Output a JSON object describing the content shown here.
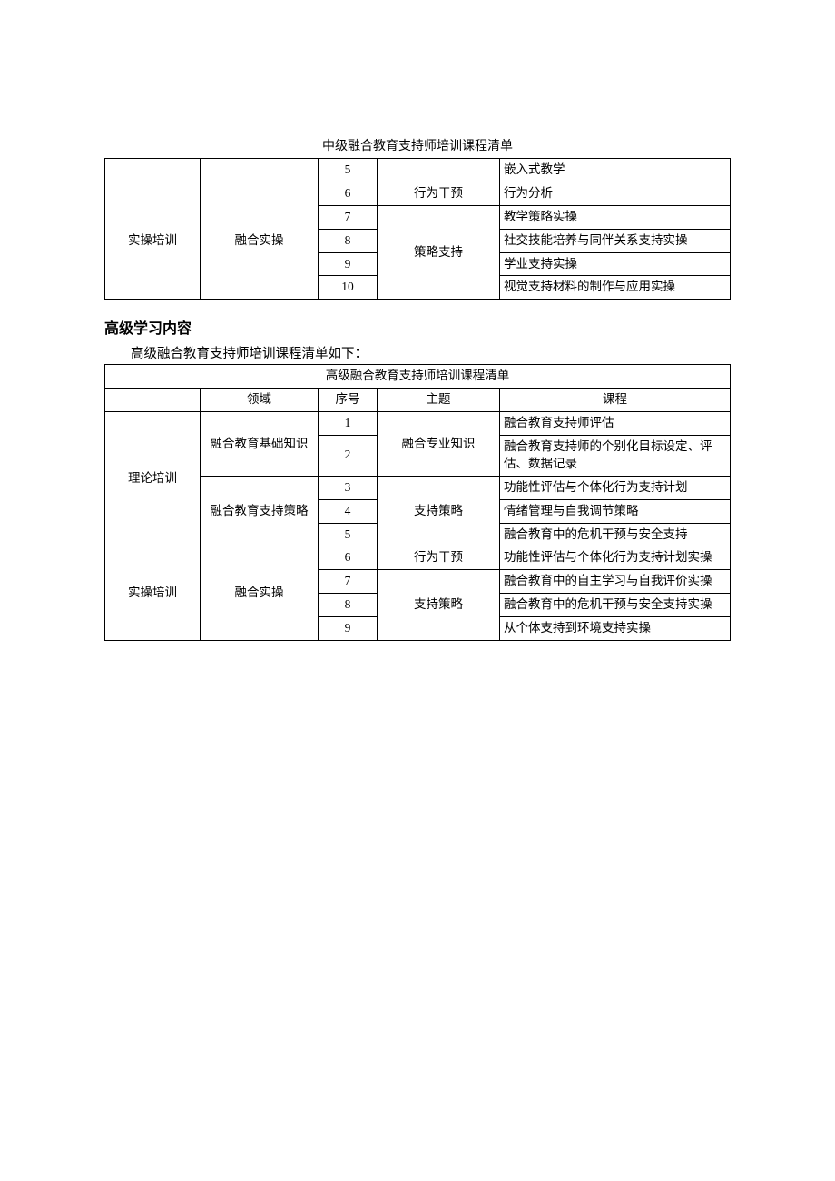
{
  "table1": {
    "title": "中级融合教育支持师培训课程清单",
    "rows": [
      {
        "seq": "5",
        "course": "嵌入式教学"
      },
      {
        "cat": "实操培训",
        "domain": "融合实操",
        "seq": "6",
        "topic": "行为干预",
        "course": "行为分析"
      },
      {
        "seq": "7",
        "topic": "策略支持",
        "course": "教学策略实操"
      },
      {
        "seq": "8",
        "course": "社交技能培养与同伴关系支持实操"
      },
      {
        "seq": "9",
        "course": "学业支持实操"
      },
      {
        "seq": "10",
        "course": "视觉支持材料的制作与应用实操"
      }
    ]
  },
  "section_header": "高级学习内容",
  "intro": "高级融合教育支持师培训课程清单如下：",
  "table2": {
    "title": "高级融合教育支持师培训课程清单",
    "headers": {
      "domain": "领域",
      "seq": "序号",
      "topic": "主题",
      "course": "课程"
    },
    "rows": [
      {
        "cat": "理论培训",
        "domain": "融合教育基础知识",
        "seq": "1",
        "topic": "融合专业知识",
        "course": "融合教育支持师评估"
      },
      {
        "seq": "2",
        "course": "融合教育支持师的个别化目标设定、评估、数据记录"
      },
      {
        "domain": "融合教育支持策略",
        "seq": "3",
        "topic": "支持策略",
        "course": "功能性评估与个体化行为支持计划"
      },
      {
        "seq": "4",
        "course": "情绪管理与自我调节策略"
      },
      {
        "seq": "5",
        "course": "融合教育中的危机干预与安全支持"
      },
      {
        "cat": "实操培训",
        "domain": "融合实操",
        "seq": "6",
        "topic": "行为干预",
        "course": "功能性评估与个体化行为支持计划实操"
      },
      {
        "seq": "7",
        "topic": "支持策略",
        "course": "融合教育中的自主学习与自我评价实操"
      },
      {
        "seq": "8",
        "course": "融合教育中的危机干预与安全支持实操"
      },
      {
        "seq": "9",
        "course": "从个体支持到环境支持实操"
      }
    ]
  }
}
